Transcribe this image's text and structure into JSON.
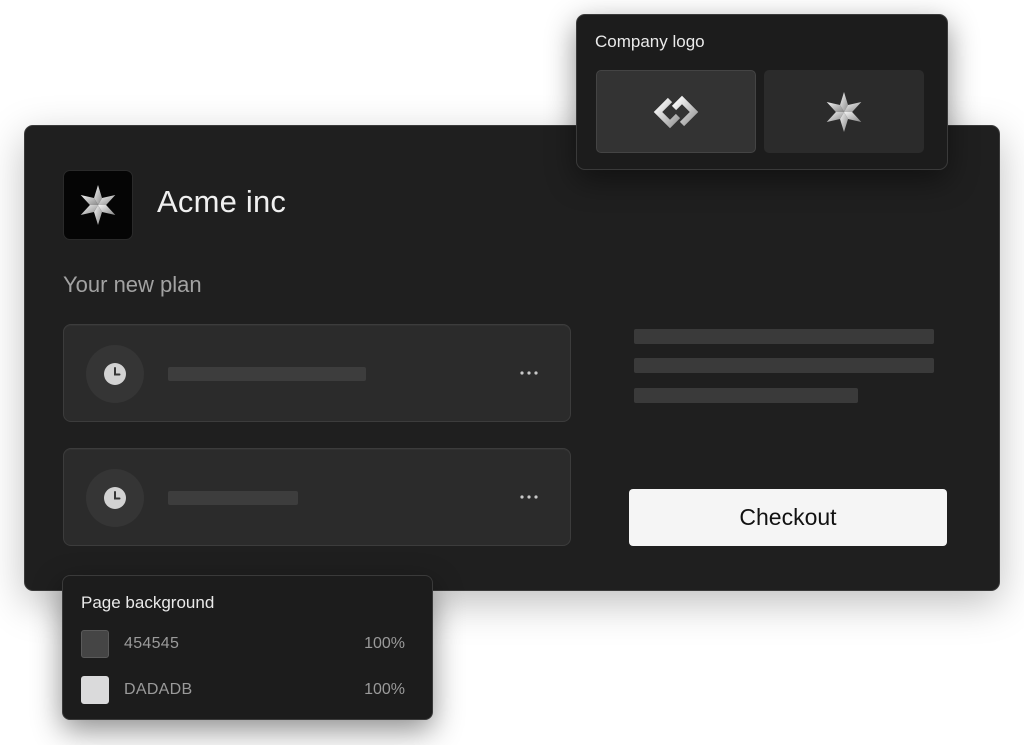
{
  "company": {
    "name": "Acme inc",
    "logo_icon": "star-logo-icon"
  },
  "plan": {
    "heading": "Your new plan",
    "items": [
      {
        "icon": "clock-icon",
        "menu_icon": "more-horizontal-icon"
      },
      {
        "icon": "clock-icon",
        "menu_icon": "more-horizontal-icon"
      }
    ]
  },
  "checkout": {
    "label": "Checkout"
  },
  "logo_picker": {
    "title": "Company logo",
    "options": [
      {
        "icon": "link-chain-logo-icon",
        "selected": true
      },
      {
        "icon": "star-logo-icon",
        "selected": false
      }
    ]
  },
  "background_picker": {
    "title": "Page background",
    "colors": [
      {
        "hex": "454545",
        "opacity": "100%",
        "swatch": "#454545"
      },
      {
        "hex": "DADADB",
        "opacity": "100%",
        "swatch": "#DADADB"
      }
    ]
  }
}
